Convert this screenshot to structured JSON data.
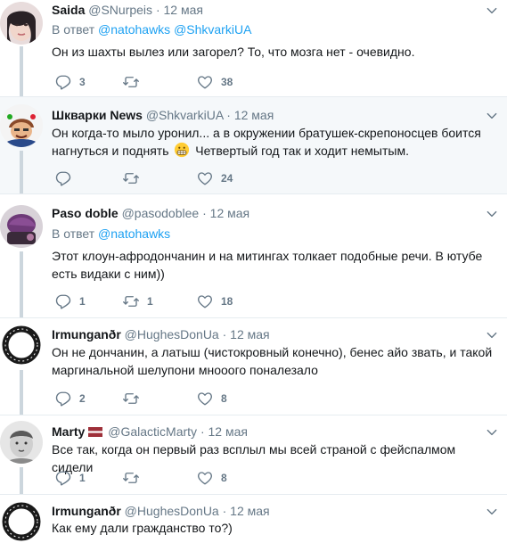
{
  "tweets": [
    {
      "name": "Saida",
      "handle": "@SNurpeis",
      "time": "12 мая",
      "reply_prefix": "В ответ",
      "reply_to": "@natohawks @ShkvarkiUA",
      "text": "Он из шахты вылез или загорел? То, что мозга нет - очевидно.",
      "replies": "3",
      "retweets": "",
      "likes": "38"
    },
    {
      "name": "Шкварки News",
      "handle": "@ShkvarkiUA",
      "time": "12 мая",
      "text_a": "Он когда-то мыло уронил... а в окружении братушек-скрепоносцев боится нагнуться и поднять",
      "text_b": "Четвертый год так и ходит немытым.",
      "replies": "",
      "retweets": "",
      "likes": "24"
    },
    {
      "name": "Paso doble",
      "handle": "@pasodoblee",
      "time": "12 мая",
      "reply_prefix": "В ответ",
      "reply_to": "@natohawks",
      "text": "Этот клоун-афродончанин и на митингах толкает подобные речи. В ютубе есть видаки с ним))",
      "replies": "1",
      "retweets": "1",
      "likes": "18"
    },
    {
      "name": "Irmunganðr",
      "handle": "@HughesDonUa",
      "time": "12 мая",
      "text": "Он не дончанин, а латыш (чистокровный конечно), бенес айо звать, и такой маргинальной шелупони мнооого поналезало",
      "replies": "2",
      "retweets": "",
      "likes": "8"
    },
    {
      "name": "Marty",
      "handle": "@GalacticMarty",
      "time": "12 мая",
      "text": "Все так, когда он первый раз всплыл мы всей страной с фейспалмом сидели",
      "replies": "1",
      "retweets": "",
      "likes": "8"
    },
    {
      "name": "Irmunganðr",
      "handle": "@HughesDonUa",
      "time": "12 мая",
      "text": "Как ему дали гражданство то?)"
    }
  ],
  "dot": "·",
  "colors": {
    "link": "#1da1f2",
    "muted": "#657786",
    "thread": "#ccd6dd",
    "text": "#14171a"
  }
}
